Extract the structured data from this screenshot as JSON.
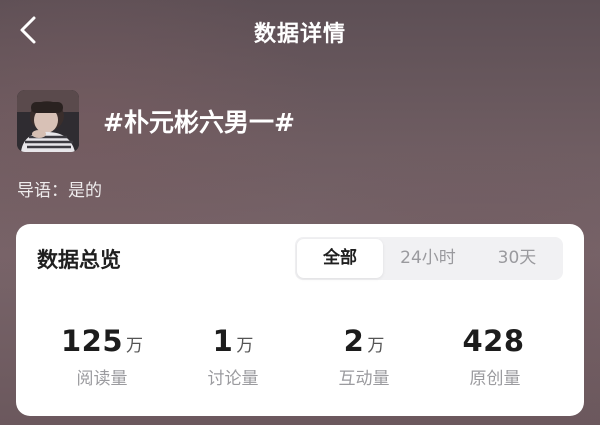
{
  "header": {
    "title": "数据详情"
  },
  "topic": {
    "title": "#朴元彬六男一#",
    "guide_label": "导语：",
    "guide_value": "是的"
  },
  "overview": {
    "title": "数据总览",
    "tabs": [
      {
        "label": "全部",
        "active": true
      },
      {
        "label": "24小时",
        "active": false
      },
      {
        "label": "30天",
        "active": false
      }
    ],
    "stats": [
      {
        "value": "125",
        "unit": "万",
        "label": "阅读量"
      },
      {
        "value": "1",
        "unit": "万",
        "label": "讨论量"
      },
      {
        "value": "2",
        "unit": "万",
        "label": "互动量"
      },
      {
        "value": "428",
        "unit": "",
        "label": "原创量"
      }
    ]
  },
  "colors": {
    "card_background": "#ffffff",
    "active_tab_text": "#1f1f1f",
    "inactive_tab_text": "#9a9a9e"
  },
  "icons": {
    "back": "chevron-left-icon",
    "avatar": "avatar-image"
  }
}
